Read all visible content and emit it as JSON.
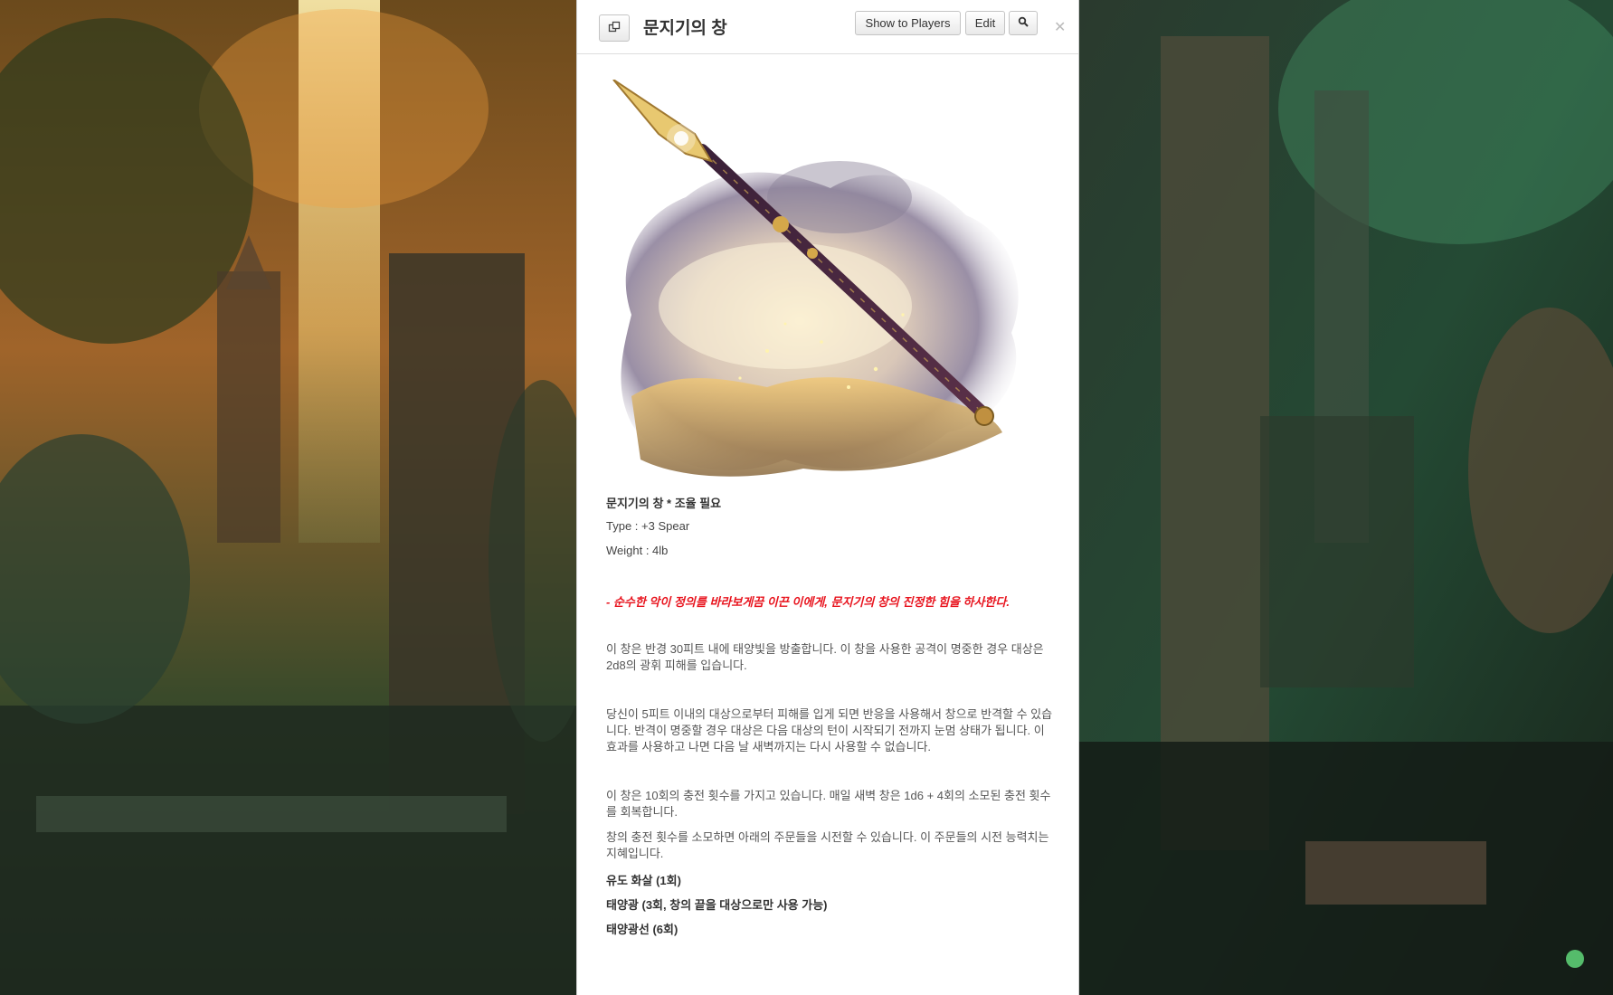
{
  "header": {
    "title": "문지기의 창",
    "show_to_players_label": "Show to Players",
    "edit_label": "Edit"
  },
  "icons": {
    "copy": "copy-icon",
    "search": "search-icon",
    "close": "close-icon"
  },
  "item": {
    "name_line": "문지기의 창 * 조율 필요",
    "type_line": "Type : +3 Spear",
    "weight_line": "Weight : 4lb",
    "quote": "- 순수한 악이 정의를 바라보게끔 이끈 이에게, 문지기의 창의 진정한 힘을 하사한다.",
    "para1": "이 창은 반경 30피트 내에 태양빛을 방출합니다. 이 창을 사용한 공격이 명중한 경우 대상은 2d8의 광휘 피해를 입습니다.",
    "para2": "당신이 5피트 이내의 대상으로부터 피해를 입게 되면 반응을 사용해서 창으로 반격할 수 있습니다. 반격이 명중할 경우 대상은 다음 대상의 턴이 시작되기 전까지 눈멈 상태가 됩니다. 이 효과를 사용하고 나면 다음 날 새벽까지는 다시 사용할 수 없습니다.",
    "para3": "이 창은 10회의 충전 횟수를 가지고 있습니다. 매일 새벽 창은 1d6 + 4회의 소모된 충전 횟수를 회복합니다.",
    "para4": "창의 충전 횟수를 소모하면 아래의 주문들을 시전할 수 있습니다. 이 주문들의 시전 능력치는 지혜입니다.",
    "spells": [
      "유도 화살 (1회)",
      "태양광 (3회, 창의 끝을 대상으로만 사용 가능)",
      "태양광선 (6회)"
    ]
  },
  "colors": {
    "quote": "#e8141e",
    "panel_bg": "#ffffff"
  }
}
